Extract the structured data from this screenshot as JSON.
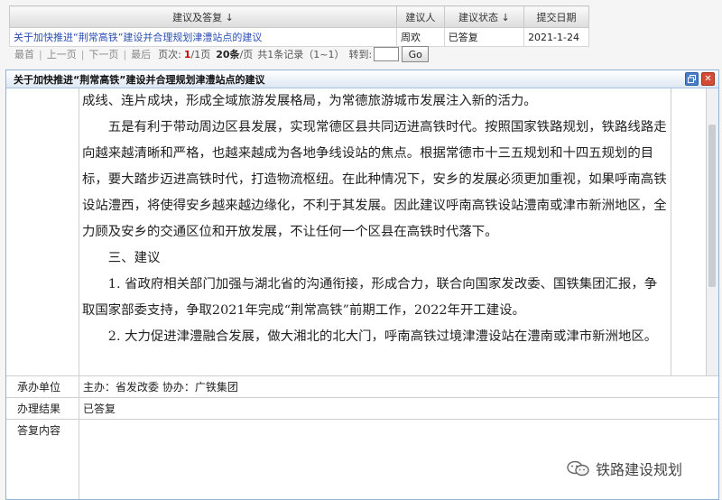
{
  "table": {
    "headers": {
      "title": "建议及答复 ↓",
      "proposer": "建议人",
      "status": "建议状态 ↓",
      "date": "提交日期"
    },
    "rows": [
      {
        "title": "关于加快推进“荆常高铁”建设并合理规划津澧站点的建议",
        "proposer": "周欢",
        "status": "已答复",
        "date": "2021-1-24"
      }
    ]
  },
  "pager": {
    "first": "最首",
    "prev": "上一页",
    "next": "下一页",
    "last": "最后",
    "page_label": "页次:",
    "page_current": "1",
    "page_total": "/1页",
    "per_page": "20条",
    "per_page_suffix": "/页",
    "total_records": "共1条记录（1~1）",
    "goto_label": "转到:",
    "goto_value": "",
    "go_button": "Go"
  },
  "dialog": {
    "title": "关于加快推进“荆常高铁”建设并合理规划津澧站点的建议",
    "paragraphs": [
      "成线、连片成块，形成全域旅游发展格局，为常德旅游城市发展注入新的活力。",
      "五是有利于带动周边区县发展，实现常德区县共同迈进高铁时代。按照国家铁路规划，铁路线路走向越来越清晰和严格，也越来越成为各地争线设站的焦点。根据常德市十三五规划和十四五规划的目标，要大踏步迈进高铁时代，打造物流枢纽。在此种情况下，安乡的发展必须更加重视，如果呼南高铁设站澧西，将使得安乡越来越边缘化，不利于其发展。因此建议呼南高铁设站澧南或津市新洲地区，全力顾及安乡的交通区位和开放发展，不让任何一个区县在高铁时代落下。",
      "三、建议",
      "1. 省政府相关部门加强与湖北省的沟通衔接，形成合力，联合向国家发改委、国铁集团汇报，争取国家部委支持，争取2021年完成“荆常高铁”前期工作，2022年开工建设。",
      "2. 大力促进津澧融合发展，做大湘北的北大门，呼南高铁过境津澧设站在澧南或津市新洲地区。"
    ],
    "fields": {
      "undertaker_label": "承办单位",
      "undertaker_value": "主办：省发改委  协办：广铁集团",
      "result_label": "办理结果",
      "result_value": "已答复",
      "reply_label": "答复内容",
      "reply_value": ""
    }
  },
  "watermark": {
    "text": "铁路建设规划",
    "icon": "wechat-icon"
  }
}
